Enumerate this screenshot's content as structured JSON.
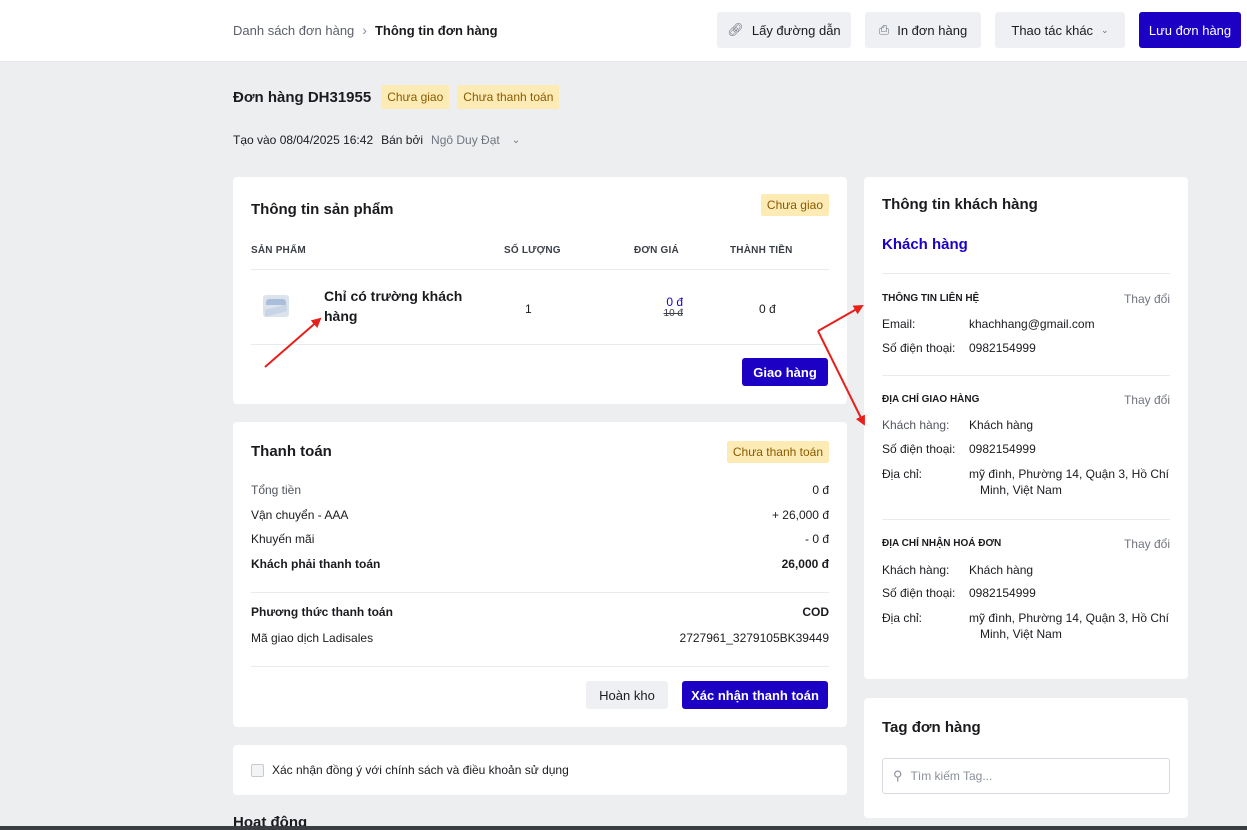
{
  "breadcrumb": {
    "parent": "Danh sách đơn hàng",
    "current": "Thông tin đơn hàng"
  },
  "toolbar": {
    "get_link": "Lấy đường dẫn",
    "print": "In đơn hàng",
    "more": "Thao tác khác",
    "save": "Lưu đơn hàng"
  },
  "order": {
    "title": "Đơn hàng DH31955",
    "status_delivery": "Chưa giao",
    "status_payment": "Chưa thanh toán",
    "created": "Tạo vào 08/04/2025 16:42",
    "sold_by_label": "Bán bởi",
    "sold_by": "Ngô Duy Đạt"
  },
  "products": {
    "title": "Thông tin sản phẩm",
    "badge": "Chưa giao",
    "headers": {
      "product": "SẢN PHẨM",
      "qty": "SỐ LƯỢNG",
      "price": "ĐƠN GIÁ",
      "total": "THÀNH TIỀN"
    },
    "items": [
      {
        "name": "Chỉ có trường khách hàng",
        "qty": "1",
        "price": "0 đ",
        "old_price": "10 đ",
        "total": "0 đ"
      }
    ],
    "deliver_button": "Giao hàng"
  },
  "payment": {
    "title": "Thanh toán",
    "badge": "Chưa thanh toán",
    "rows": [
      {
        "label": "Tổng tiền",
        "value": "0 đ"
      },
      {
        "label": "Vận chuyển - AAA",
        "value": "+ 26,000 đ"
      },
      {
        "label": "Khuyến mãi",
        "value": "- 0 đ"
      },
      {
        "label": "Khách phải thanh toán",
        "value": "26,000 đ"
      }
    ],
    "method_label": "Phương thức thanh toán",
    "method_value": "COD",
    "txn_label": "Mã giao dịch Ladisales",
    "txn_value": "2727961_3279105BK39449",
    "restock_button": "Hoàn kho",
    "confirm_button": "Xác nhận thanh toán"
  },
  "terms": {
    "label": "Xác nhận đồng ý với chính sách và điều khoản sử dụng"
  },
  "activity": {
    "title": "Hoạt động"
  },
  "customer": {
    "title": "Thông tin khách hàng",
    "name": "Khách hàng",
    "change": "Thay đổi",
    "contact": {
      "heading": "THÔNG TIN LIÊN HỆ",
      "email_label": "Email:",
      "email": "khachhang@gmail.com",
      "phone_label": "Số điện thoại:",
      "phone": "0982154999"
    },
    "shipping": {
      "heading": "ĐỊA CHỈ GIAO HÀNG",
      "customer_label": "Khách hàng:",
      "customer": "Khách hàng",
      "phone_label": "Số điện thoại:",
      "phone": "0982154999",
      "address_label": "Địa chỉ:",
      "address_line1": "mỹ đình, Phường 14, Quận 3, Hồ Chí",
      "address_line2": "Minh, Việt Nam"
    },
    "billing": {
      "heading": "ĐỊA CHỈ NHẬN HOÁ ĐƠN",
      "customer_label": "Khách hàng:",
      "customer": "Khách hàng",
      "phone_label": "Số điện thoại:",
      "phone": "0982154999",
      "address_label": "Địa chỉ:",
      "address_line1": "mỹ đình, Phường 14, Quận 3, Hồ Chí",
      "address_line2": "Minh, Việt Nam"
    }
  },
  "tags": {
    "title": "Tag đơn hàng",
    "search_placeholder": "Tìm kiếm Tag..."
  },
  "colors": {
    "primary": "#1c00c4",
    "badge_bg": "#fdebb5",
    "badge_text": "#8a5a00",
    "arrow": "#e8201c"
  }
}
